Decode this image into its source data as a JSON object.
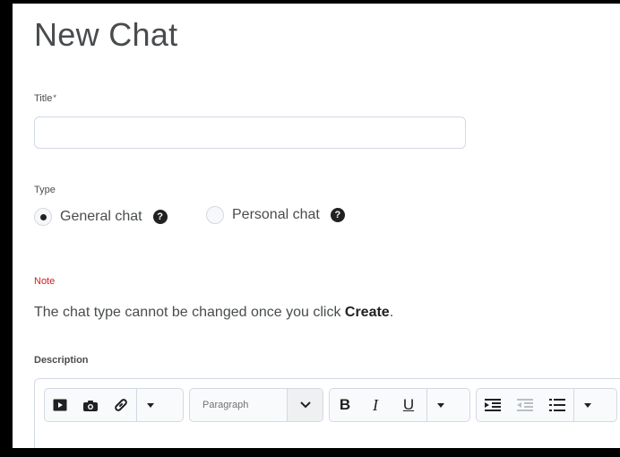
{
  "page": {
    "title": "New Chat"
  },
  "form": {
    "title_label": "Title",
    "required_mark": "*",
    "title_value": "",
    "title_placeholder": "",
    "type_label": "Type",
    "type_options": [
      {
        "label": "General chat",
        "selected": true,
        "help": "?"
      },
      {
        "label": "Personal chat",
        "selected": false,
        "help": "?"
      }
    ],
    "note_label": "Note",
    "note_text": "The chat type cannot be changed once you click ",
    "note_emphasis": "Create",
    "note_end": ".",
    "description_label": "Description"
  },
  "editor": {
    "format_value": "Paragraph",
    "bold_label": "B",
    "italic_label": "I",
    "underline_label": "U"
  },
  "colors": {
    "note": "#cd2026",
    "text": "#494c4e",
    "border": "#d3d9e3"
  }
}
